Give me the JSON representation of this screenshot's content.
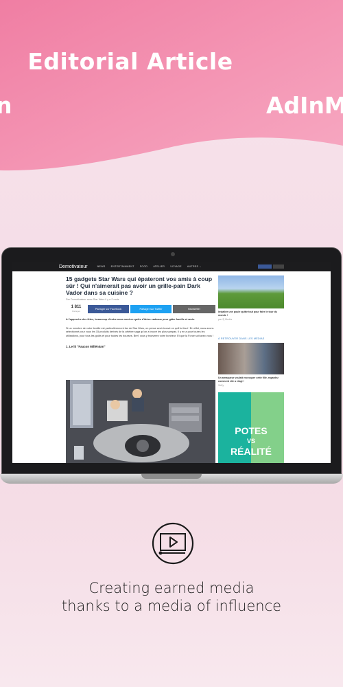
{
  "hero": {
    "title": "Editorial Article",
    "left_fragment": "n",
    "right_fragment": "AdInM"
  },
  "site": {
    "brand": "Demotivateur",
    "nav": [
      "NEWS",
      "ENTERTAINMENT",
      "FOOD",
      "ATELIER",
      "VOYAGE",
      "AUTRES ⌄"
    ]
  },
  "article": {
    "title": "15 gadgets Star Wars qui épateront vos amis à coup sûr ! Qui n'aimerait pas avoir un grille-pain Dark Vador dans sa cuisine ?",
    "byline": "Par Demotivateur avec Star Wars il y a 2 mois",
    "share_count": "1 811",
    "share_count_label": "Partages",
    "share_facebook": "Partager sur Facebook",
    "share_twitter": "Partager sur Twitter",
    "newsletter": "Newsletter",
    "intro": "A l'approche des fêtes, beaucoup d'entre nous sont en quête d'idées cadeaux pour gâter famille et amis.",
    "body": "Si un membre de votre famille est particulièrement fan de Star Wars, on pense avoir trouvé ce qu'il lui faut ! En effet, nous avons sélectionné pour vous les 15 produits dérivés de la célèbre saga qu'on a trouvé les plus sympas. Il y en a pour toutes les utilisations, pour tous les goûts et pour toutes les bourses. Bref, vous y trouverez votre bonheur. Et que la Force soit avec vous !",
    "section": "1. Le lit \"Faucon Millénium\""
  },
  "sidebar": {
    "caption1": "Installée une poule quitte tout pour faire le tour du monde !",
    "source1": "par Zj Media",
    "heading": "À RETROUVER DANS LES MÉDIAS",
    "caption2": "Un arnaqueur voulait escroquer cette fille, regardez comment elle a réagi !",
    "source2": "Seffy",
    "ad_line1": "POTES",
    "ad_line2": "VS",
    "ad_line3": "RÉALITÉ"
  },
  "footer": {
    "icon": "video-play-icon",
    "caption_line1": "Creating earned media",
    "caption_line2": "thanks to a media of influence"
  },
  "colors": {
    "hero_pink": "#f288aa",
    "hero_pink_light": "#f5a2bd",
    "facebook": "#3b5998",
    "twitter": "#1da1f2",
    "ad_teal": "#1bb39e",
    "ad_green": "#83d08a"
  }
}
